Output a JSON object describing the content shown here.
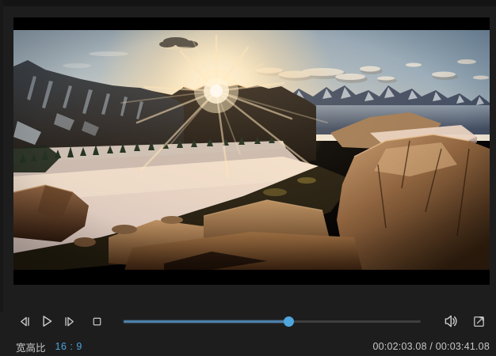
{
  "app": {
    "background": "#1d1d1d",
    "accent_color": "#4da3dd"
  },
  "video": {
    "scene_name": "mountain-sunset-timelapse-frame",
    "letterbox_color": "#000000"
  },
  "transport": {
    "prev_frame_icon": "step-backward-icon",
    "play_icon": "play-icon",
    "next_frame_icon": "step-forward-icon",
    "stop_icon": "stop-icon"
  },
  "seek": {
    "progress_percent": 55.7,
    "fill_color": "#4d80ab",
    "thumb_color": "#4fa6dd"
  },
  "audio": {
    "volume_icon": "speaker-icon"
  },
  "view": {
    "fullscreen_icon": "fullscreen-expand-icon"
  },
  "status": {
    "aspect_label": "宽高比",
    "aspect_value": "16 : 9",
    "current_time": "00:02:03.08",
    "total_time": "00:03:41.08",
    "time_display": "00:02:03.08 / 00:03:41.08"
  }
}
